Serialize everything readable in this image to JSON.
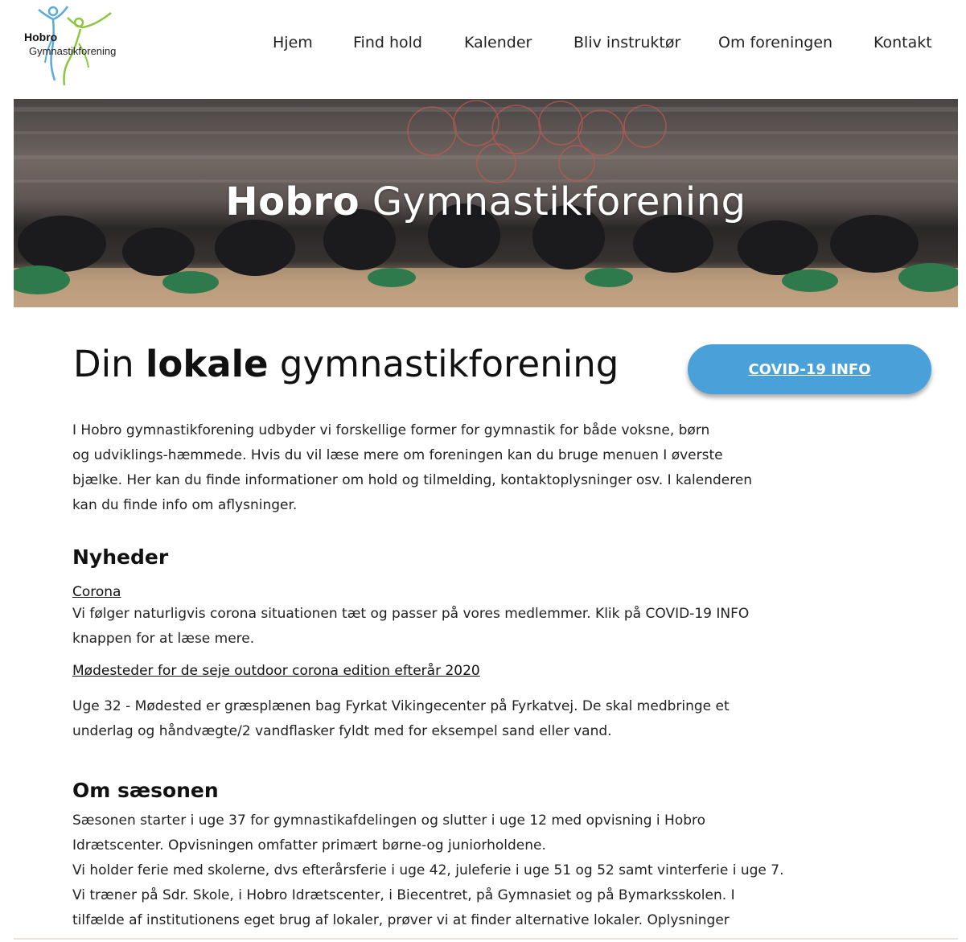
{
  "logo": {
    "line1": "Hobro",
    "line2": "Gymnastikforening"
  },
  "nav": [
    "Hjem",
    "Find hold",
    "Kalender",
    "Bliv instruktør",
    "Om foreningen",
    "Kontakt"
  ],
  "hero": {
    "title_bold": "Hobro",
    "title_rest": "Gymnastikforening"
  },
  "main": {
    "heading_pre": "Din",
    "heading_bold": "lokale",
    "heading_post": "gymnastikforening",
    "covid_button": "COVID-19 INFO",
    "intro": [
      "I Hobro gymnastikforening udbyder vi forskellige former for gymnastik for både voksne, børn",
      "og udviklings-hæmmede. Hvis du vil læse mere om foreningen kan du bruge menuen I øverste",
      "bjælke. Her kan du finde informationer om hold og tilmelding, kontaktoplysninger osv. I kalenderen",
      "kan du finde info om aflysninger."
    ]
  },
  "news": {
    "heading": "Nyheder",
    "items": [
      {
        "title": "Corona",
        "lines": [
          "Vi følger naturligvis corona situationen tæt og passer på vores medlemmer. Klik på COVID-19 INFO",
          "knappen for at læse mere."
        ]
      },
      {
        "title": "Mødesteder for de seje outdoor corona edition efterår 2020",
        "lines": [
          "Uge 32 - Mødested er græsplænen bag Fyrkat Vikingecenter på Fyrkatvej. De skal medbringe et",
          "underlag og håndvægte/2 vandflasker fyldt med for eksempel sand eller vand."
        ]
      }
    ]
  },
  "season": {
    "heading": "Om sæsonen",
    "lines": [
      "Sæsonen starter i uge 37 for gymnastikafdelingen og slutter i uge 12 med opvisning i Hobro",
      "Idrætscenter. Opvisningen omfatter primært børne-og juniorholdene.",
      "Vi holder ferie med skolerne, dvs efterårsferie i uge 42, juleferie i uge  51 og 52 samt vinterferie i uge 7.",
      "Vi træner på Sdr. Skole, i Hobro Idrætscenter, i Biecentret, på Gymnasiet og på Bymarksskolen. I",
      "tilfælde af institutionens eget brug af lokaler, prøver vi at finder alternative lokaler. Oplysninger"
    ]
  },
  "colors": {
    "accent": "#4aa0d9",
    "logo_blue": "#5aa9de",
    "logo_green": "#8dc63f"
  }
}
